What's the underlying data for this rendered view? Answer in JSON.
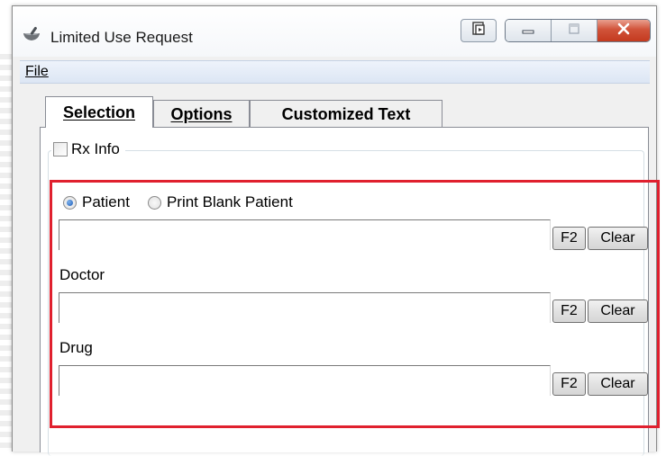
{
  "window": {
    "title": "Limited Use Request"
  },
  "menu": {
    "file": "File"
  },
  "tabs": [
    {
      "label": "Selection",
      "selected": true
    },
    {
      "label": "Options",
      "selected": false
    },
    {
      "label": "Customized Text",
      "selected": false
    }
  ],
  "rx_info": {
    "label": "Rx Info",
    "checked": false
  },
  "patient_mode": {
    "options": [
      "Patient",
      "Print Blank Patient"
    ],
    "selected": "Patient"
  },
  "fields": {
    "patient": {
      "value": "",
      "f2": "F2",
      "clear": "Clear"
    },
    "doctor": {
      "label": "Doctor",
      "value": "",
      "f2": "F2",
      "clear": "Clear"
    },
    "drug": {
      "label": "Drug",
      "value": "",
      "f2": "F2",
      "clear": "Clear"
    }
  },
  "colors": {
    "highlight_border": "#e0202e",
    "close_button": "#c43a1f"
  },
  "icons": {
    "app": "mortar-pestle-icon",
    "help": "help-context-icon",
    "minimize": "minimize-icon",
    "maximize": "maximize-icon",
    "close": "close-icon"
  }
}
